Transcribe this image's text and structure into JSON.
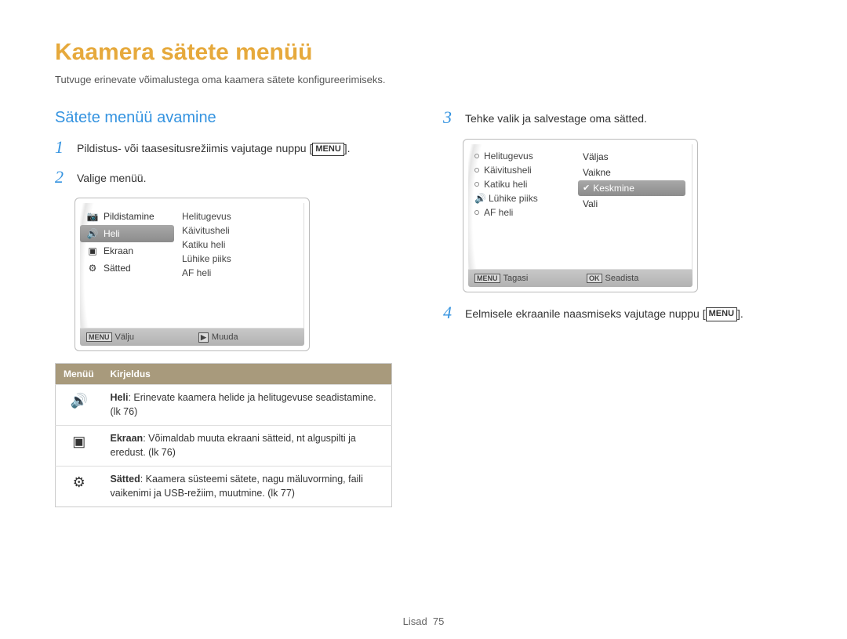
{
  "page_title": "Kaamera sätete menüü",
  "intro": "Tutvuge erinevate võimalustega oma kaamera sätete konfigureerimiseks.",
  "section_title": "Sätete menüü avamine",
  "steps": {
    "s1_text": "Pildistus- või taasesitusrežiimis vajutage nuppu [",
    "s1_btn": "MENU",
    "s1_after": "].",
    "s2_text": "Valige menüü.",
    "s3_text": "Tehke valik ja salvestage oma sätted.",
    "s4_text": "Eelmisele ekraanile naasmiseks vajutage nuppu [",
    "s4_btn": "MENU",
    "s4_after": "]."
  },
  "lcd1": {
    "left": [
      "Pildistamine",
      "Heli",
      "Ekraan",
      "Sätted"
    ],
    "right": [
      "Helitugevus",
      "Käivitusheli",
      "Katiku heli",
      "Lühike piiks",
      "AF heli"
    ],
    "bottom_left_lbl": "MENU",
    "bottom_left": "Välju",
    "bottom_right_lbl": "▶",
    "bottom_right": "Muuda"
  },
  "lcd2": {
    "left": [
      "Helitugevus",
      "Käivitusheli",
      "Katiku heli",
      "Lühike piiks",
      "AF heli"
    ],
    "right": [
      "Väljas",
      "Vaikne",
      "Keskmine",
      "Vali"
    ],
    "bottom_left_lbl": "MENU",
    "bottom_left": "Tagasi",
    "bottom_right_lbl": "OK",
    "bottom_right": "Seadista"
  },
  "table": {
    "h1": "Menüü",
    "h2": "Kirjeldus",
    "rows": [
      {
        "icon": "sound",
        "bold": "Heli",
        "text": ": Erinevate kaamera helide ja helitugevuse seadistamine. (lk 76)"
      },
      {
        "icon": "display",
        "bold": "Ekraan",
        "text": ": Võimaldab muuta ekraani sätteid, nt alguspilti ja eredust. (lk 76)"
      },
      {
        "icon": "gear",
        "bold": "Sätted",
        "text": ": Kaamera süsteemi sätete, nagu mäluvorming, faili vaikenimi ja USB-režiim, muutmine. (lk 77)"
      }
    ]
  },
  "footer_label": "Lisad",
  "footer_page": "75"
}
